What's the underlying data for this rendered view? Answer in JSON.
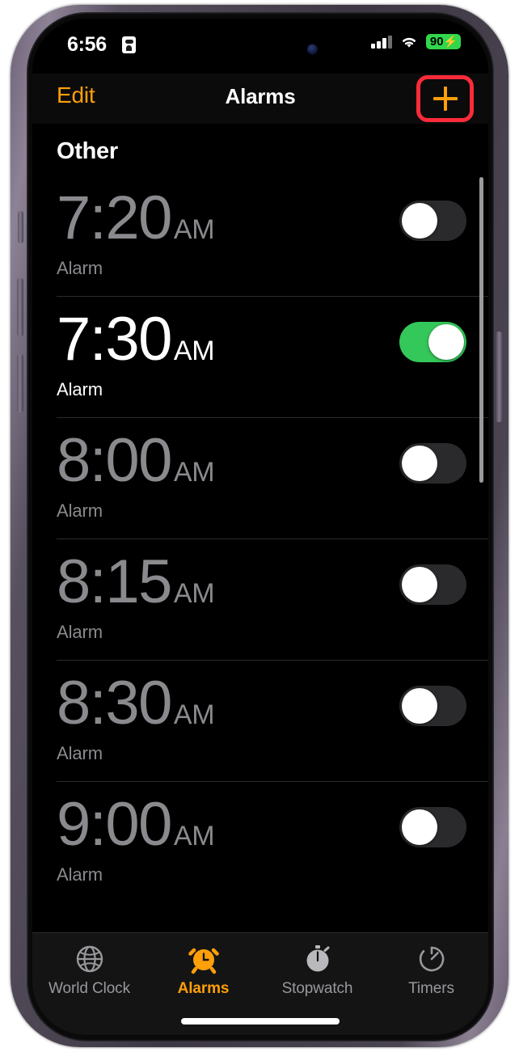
{
  "status_bar": {
    "time": "6:56",
    "lock_icon": "portrait-lock-icon",
    "signal_icon": "cellular-signal-icon",
    "wifi_icon": "wifi-icon",
    "battery_percent": "90",
    "battery_charging_glyph": "⚡",
    "battery_color": "#32d74b"
  },
  "nav_bar": {
    "edit_label": "Edit",
    "title": "Alarms",
    "add_icon": "plus-icon",
    "add_highlight_color": "#fb2b3a",
    "accent_color": "#ff9f0a"
  },
  "alarm_list": {
    "section_header": "Other",
    "alarms": [
      {
        "time": "7:20",
        "meridiem": "AM",
        "label": "Alarm",
        "enabled": false
      },
      {
        "time": "7:30",
        "meridiem": "AM",
        "label": "Alarm",
        "enabled": true
      },
      {
        "time": "8:00",
        "meridiem": "AM",
        "label": "Alarm",
        "enabled": false
      },
      {
        "time": "8:15",
        "meridiem": "AM",
        "label": "Alarm",
        "enabled": false
      },
      {
        "time": "8:30",
        "meridiem": "AM",
        "label": "Alarm",
        "enabled": false
      },
      {
        "time": "9:00",
        "meridiem": "AM",
        "label": "Alarm",
        "enabled": false
      }
    ],
    "toggle_on_color": "#34c759",
    "toggle_off_color": "#2a2a2c"
  },
  "tab_bar": {
    "tabs": [
      {
        "label": "World Clock",
        "icon": "globe-icon",
        "active": false
      },
      {
        "label": "Alarms",
        "icon": "alarm-clock-icon",
        "active": true
      },
      {
        "label": "Stopwatch",
        "icon": "stopwatch-icon",
        "active": false
      },
      {
        "label": "Timers",
        "icon": "timer-icon",
        "active": false
      }
    ]
  }
}
